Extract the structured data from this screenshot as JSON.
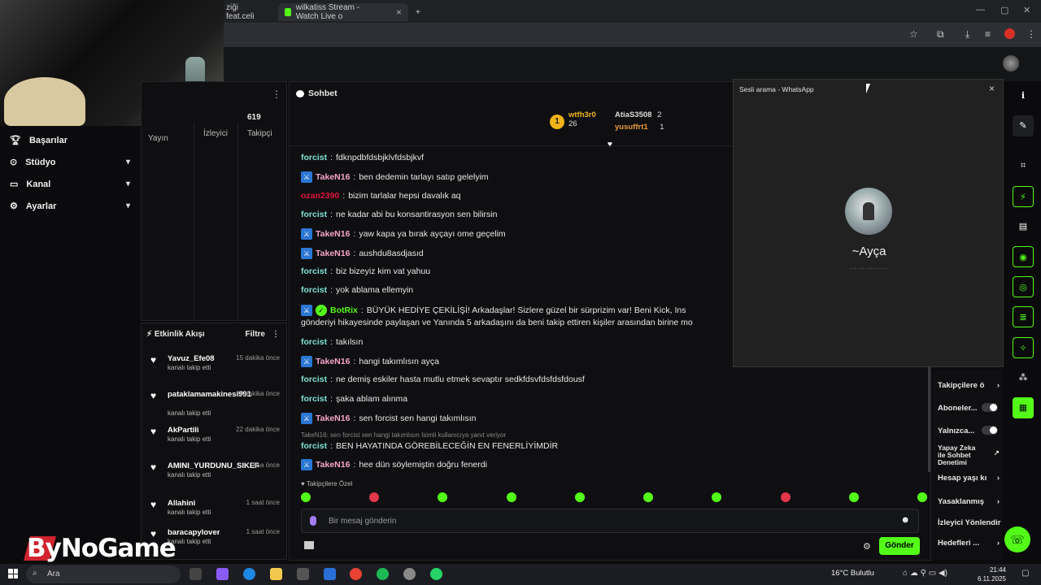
{
  "browser": {
    "tabs": [
      {
        "title": "ziği feat.celi"
      },
      {
        "title": "wilkatiss Stream - Watch Live o"
      }
    ],
    "new_tab": "+"
  },
  "nav": {
    "items": [
      {
        "label": "Başarılar",
        "icon": "trophy-icon"
      },
      {
        "label": "Stüdyo",
        "icon": "studio-icon"
      },
      {
        "label": "Kanal",
        "icon": "channel-icon"
      },
      {
        "label": "Ayarlar",
        "icon": "gear-icon"
      }
    ]
  },
  "stats": {
    "followers_count": "619",
    "cols": [
      "Yayın",
      "İzleyici",
      "Takipçi"
    ]
  },
  "activity": {
    "title": "Etkinlik Akışı",
    "filter": "Filtre",
    "items": [
      {
        "name": "Yavuz_Efe08",
        "time": "15 dakika önce",
        "desc": "kanalı takip etti"
      },
      {
        "name": "pataklamamakinesi991",
        "time": "19 dakika önce",
        "desc": "kanalı takip etti"
      },
      {
        "name": "AkPartili",
        "time": "22 dakika önce",
        "desc": "kanalı takip etti"
      },
      {
        "name": "AMINI_YURDUNU_SIKERIM",
        "time": "saa önce",
        "desc": "kanalı takip etti"
      },
      {
        "name": "Allahini",
        "time": "1 saat önce",
        "desc": "kanalı takip etti"
      },
      {
        "name": "baracapylover",
        "time": "1 saat önce",
        "desc": "kanalı takip etti"
      }
    ]
  },
  "chat": {
    "title": "Sohbet",
    "leaderboard": {
      "first": {
        "rank": "1",
        "name": "wtfh3r0",
        "count": "26"
      },
      "second": {
        "name": "AtiaS3508",
        "count": "2"
      },
      "third": {
        "name": "yusuffrt1",
        "count": "1"
      }
    },
    "messages": [
      {
        "user": "forcist",
        "text": "fdknpdbfdsbjklvfdsbjkvf",
        "cls": "u-forcist",
        "badge": false
      },
      {
        "user": "TakeN16",
        "text": "ben dedemin tarlayı satıp gelelyim",
        "cls": "u-taken",
        "badge": true
      },
      {
        "user": "ozan2390",
        "text": "bizim tarlalar hepsi davalık aq",
        "cls": "u-ozan",
        "badge": false
      },
      {
        "user": "forcist",
        "text": "ne kadar abi bu konsantirasyon sen bilirsin",
        "cls": "u-forcist",
        "badge": false
      },
      {
        "user": "TakeN16",
        "text": "yaw kapa ya bırak ayçayı ome geçelim",
        "cls": "u-taken",
        "badge": true
      },
      {
        "user": "TakeN16",
        "text": "aushdu8asdjasıd",
        "cls": "u-taken",
        "badge": true
      },
      {
        "user": "forcist",
        "text": "biz bizeyiz kim vat yahuu",
        "cls": "u-forcist",
        "badge": false
      },
      {
        "user": "forcist",
        "text": "yok ablama ellemyin",
        "cls": "u-forcist",
        "badge": false
      }
    ],
    "botrix": {
      "user": "BotRix",
      "line1": "BÜYÜK HEDİYE ÇEKİLİŞİ! Arkadaşlar! Sizlere güzel bir sürprizim var! Beni Kick, Ins",
      "line2": "gönderiyi hikayesinde paylaşan ve   Yanında 5 arkadaşını da beni takip ettiren kişiler arasından birine mo"
    },
    "messages2": [
      {
        "user": "forcist",
        "text": "takılsın",
        "cls": "u-forcist",
        "badge": false
      },
      {
        "user": "TakeN16",
        "text": "hangi takımlısın ayça",
        "cls": "u-taken",
        "badge": true
      },
      {
        "user": "forcist",
        "text": "ne demiş eskiler hasta mutlu etmek sevaptır sedkfdsvfdsfdsfdousf",
        "cls": "u-forcist",
        "badge": false
      },
      {
        "user": "forcist",
        "text": "şaka ablam alınma",
        "cls": "u-forcist",
        "badge": false
      },
      {
        "user": "TakeN16",
        "text": "sen forcist sen hangi takımlısın",
        "cls": "u-taken",
        "badge": true
      }
    ],
    "reply_note": "TakeN16: sen forcist sen hangi takımlısın İsimli kullanıcıya yanıt veriyor",
    "messages3": [
      {
        "user": "forcist",
        "text": "BEN HAYATINDA GÖREBİLECEĞİN EN FENERLİYİMDİR",
        "cls": "u-forcist",
        "badge": false
      },
      {
        "user": "TakeN16",
        "text": "hee dün söylemiştin doğru fenerdi",
        "cls": "u-taken",
        "badge": true
      }
    ],
    "follow_only": "Takipçilere Özel",
    "placeholder": "Bir mesaj gönderin",
    "send": "Gönder"
  },
  "whatsapp": {
    "title": "Sesli arama - WhatsApp",
    "contact": "~Ayça",
    "status": "..............."
  },
  "settings": {
    "items": [
      {
        "label": "Takipçilere ö",
        "kind": "arrow"
      },
      {
        "label": "Aboneler...",
        "kind": "toggle"
      },
      {
        "label": "Yalnızca...",
        "kind": "toggle"
      },
      {
        "label": "Yapay Zeka ile Sohbet Denetimi",
        "kind": "link"
      },
      {
        "label": "Hesap yaşı kı",
        "kind": "arrow"
      },
      {
        "label": "Yasaklanmış",
        "kind": "arrow"
      },
      {
        "label": "İzleyici Yönlendir",
        "kind": "none"
      },
      {
        "label": "Hedefleri ...",
        "kind": "arrow"
      }
    ]
  },
  "logo": {
    "text": "ByNoGame"
  },
  "taskbar": {
    "search": "Ara",
    "weather": "16°C  Bulutlu",
    "time": "21:44",
    "date": "6.11.2025"
  }
}
